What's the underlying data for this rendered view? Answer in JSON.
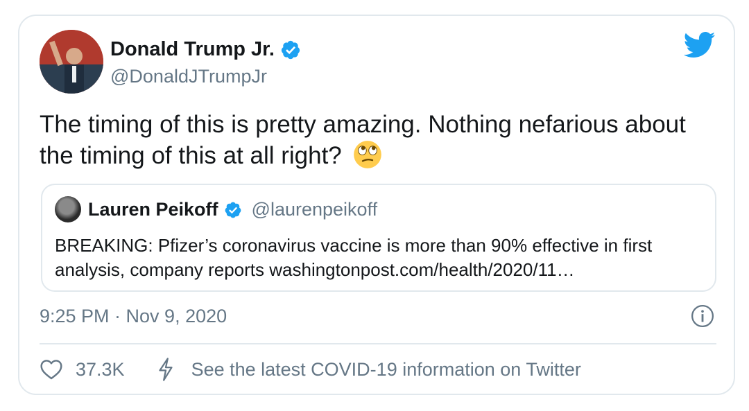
{
  "author": {
    "name": "Donald Trump Jr.",
    "handle": "@DonaldJTrumpJr",
    "verified": true
  },
  "tweet": {
    "text": "The timing of this is pretty amazing. Nothing nefarious about the timing of this at all right?",
    "emoji": "face-with-rolling-eyes",
    "timestamp": "9:25 PM · Nov 9, 2020"
  },
  "quoted_tweet": {
    "name": "Lauren Peikoff",
    "handle": "@laurenpeikoff",
    "verified": true,
    "text": "BREAKING: Pfizer’s coronavirus vaccine is more than 90% effective in first analysis, company reports washingtonpost.com/health/2020/11…"
  },
  "actions": {
    "like_count": "37.3K",
    "covid_link": "See the latest COVID-19 information on Twitter"
  },
  "colors": {
    "twitter_blue": "#1da1f2",
    "muted_text": "#657786",
    "border": "#e1e8ed"
  }
}
